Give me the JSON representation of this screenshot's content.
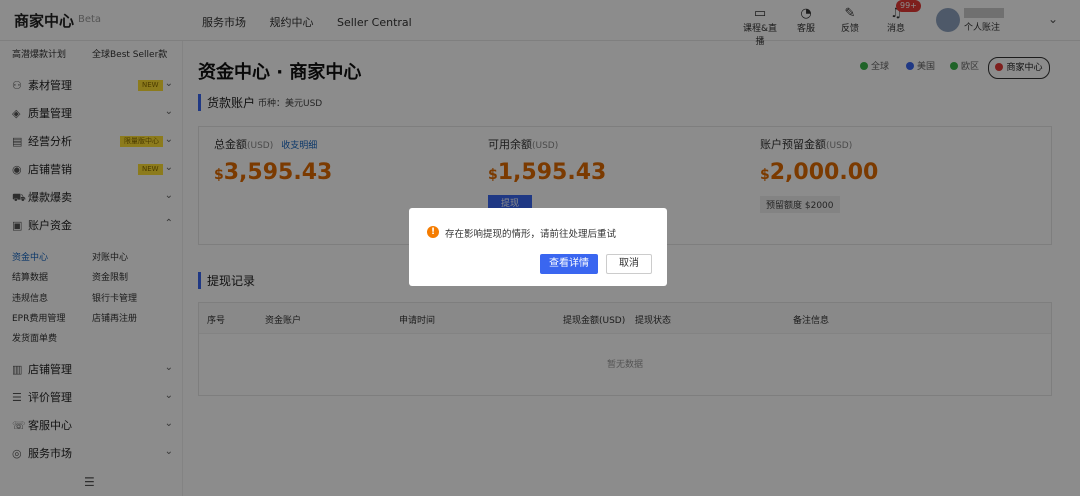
{
  "header": {
    "logo": "商家中心",
    "beta": "Beta",
    "nav": [
      "服务市场",
      "规约中心",
      "Seller Central"
    ],
    "icons": [
      {
        "label": "课程&直播",
        "icon": "book-icon"
      },
      {
        "label": "客服",
        "icon": "headset-icon"
      },
      {
        "label": "反馈",
        "icon": "feedback-icon"
      },
      {
        "label": "消息",
        "icon": "bell-icon"
      }
    ],
    "badge": "99+",
    "user_name": "个人账注"
  },
  "sidebar": {
    "top_links": [
      "高潜爆款计划",
      "全球Best Seller款"
    ],
    "items": [
      {
        "label": "素材管理",
        "tag": "NEW",
        "icon": "material-icon"
      },
      {
        "label": "质量管理",
        "icon": "shield-icon"
      },
      {
        "label": "经营分析",
        "tag": "限量版中心",
        "icon": "chart-icon"
      },
      {
        "label": "店铺营销",
        "tag": "NEW",
        "icon": "marketing-icon"
      },
      {
        "label": "爆款爆卖",
        "icon": "cart-icon"
      },
      {
        "label": "账户资金",
        "icon": "wallet-icon"
      }
    ],
    "sub_items": [
      "资金中心",
      "对账中心",
      "结算数据",
      "资金限制",
      "违规信息",
      "银行卡管理",
      "EPR费用管理",
      "店铺再注册",
      "发货面单费"
    ],
    "bottom_items": [
      {
        "label": "店铺管理",
        "icon": "store-icon"
      },
      {
        "label": "评价管理",
        "icon": "review-icon"
      },
      {
        "label": "客服中心",
        "icon": "chat-icon"
      },
      {
        "label": "服务市场",
        "icon": "service-icon"
      }
    ]
  },
  "main": {
    "title": "资金中心 · 商家中心",
    "regions": [
      "全球",
      "美国",
      "欧区",
      "商家中心"
    ],
    "section_account": "货款账户",
    "currency_note": "币种：美元USD",
    "cards": [
      {
        "label": "总金额",
        "unit": "(USD)",
        "link": "收支明细",
        "amount": "3,595.43"
      },
      {
        "label": "可用余额",
        "unit": "(USD)",
        "amount": "1,595.43",
        "button": "提现"
      },
      {
        "label": "账户预留金额",
        "unit": "(USD)",
        "amount": "2,000.00",
        "note": "预留额度 $2000"
      }
    ],
    "currency_symbol": "$",
    "section_records": "提现记录",
    "table_headers": [
      "序号",
      "资金账户",
      "申请时间",
      "提现金额(USD)",
      "提现状态",
      "备注信息"
    ],
    "empty_text": "暂无数据"
  },
  "dialog": {
    "message": "存在影响提现的情形，请前往处理后重试",
    "primary": "查看详情",
    "cancel": "取消"
  },
  "colors": {
    "primary": "#3a66f0",
    "amount": "#e06a00",
    "warning": "#f57c00"
  }
}
